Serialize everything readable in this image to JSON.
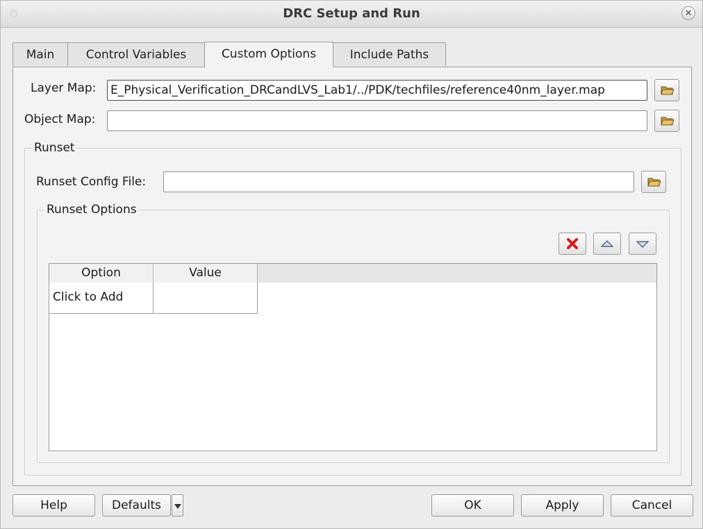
{
  "window": {
    "title": "DRC Setup and Run"
  },
  "tabs": [
    {
      "label": "Main"
    },
    {
      "label": "Control Variables"
    },
    {
      "label": "Custom Options"
    },
    {
      "label": "Include Paths"
    }
  ],
  "active_tab": "Custom Options",
  "layer_map": {
    "label": "Layer Map:",
    "value": "E_Physical_Verification_DRCandLVS_Lab1/../PDK/techfiles/reference40nm_layer.map"
  },
  "object_map": {
    "label": "Object Map:",
    "value": ""
  },
  "runset": {
    "group_title": "Runset",
    "config_file_label": "Runset Config File:",
    "config_file_value": "",
    "options": {
      "group_title": "Runset Options",
      "columns": [
        "Option",
        "Value"
      ],
      "rows": [
        {
          "option": "Click to Add",
          "value": ""
        }
      ]
    }
  },
  "icons": {
    "folder": "folder-open-icon",
    "delete": "red-x-delete-icon",
    "move_up": "triangle-up-icon",
    "move_down": "triangle-down-icon"
  },
  "colors": {
    "delete_red": "#d81818",
    "arrow_blue": "#5c7fb0"
  },
  "footer": {
    "help": "Help",
    "defaults": "Defaults",
    "ok": "OK",
    "apply": "Apply",
    "cancel": "Cancel"
  }
}
